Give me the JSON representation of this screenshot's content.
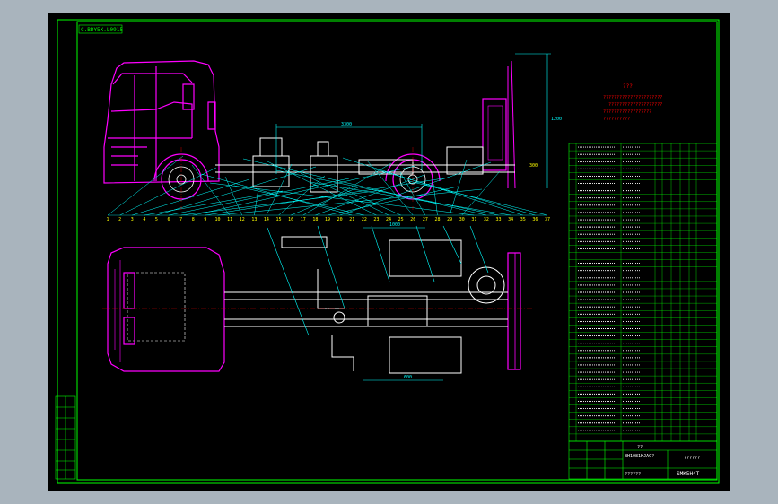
{
  "drawing": {
    "label_box": "C.BDY5X.L0915",
    "notes_title": "???",
    "notes_lines": [
      "??????????????????????",
      "????????????????????",
      "??????????????????",
      "??????????"
    ],
    "dim_wheelbase": "3300",
    "dim_rear_overhang": "300",
    "dim_height": "1200",
    "dim_plan_top": "1000",
    "dim_plan_bottom": "600",
    "item_numbers": [
      "1",
      "2",
      "3",
      "4",
      "5",
      "6",
      "7",
      "8",
      "9",
      "10",
      "11",
      "12",
      "13",
      "14",
      "15",
      "16",
      "17",
      "18",
      "19",
      "20",
      "21",
      "22",
      "23",
      "24",
      "25",
      "26",
      "27",
      "28",
      "29",
      "30",
      "31",
      "32",
      "33",
      "34",
      "35",
      "36",
      "37"
    ]
  },
  "bom": {
    "header_qty": "??",
    "row_count": 41
  },
  "title_block": {
    "project": "??????",
    "drawing_name": "BH1081KJAG?",
    "scale_label": "??",
    "drawing_code": "SMK5H4T",
    "company": "??????"
  },
  "colors": {
    "paper": "#a9b4bd",
    "background": "#000000",
    "frame": "#00ff00",
    "truck": "#ff00ff",
    "parts": "#ffffff",
    "leaders": "#00ffff",
    "notes": "#ff0000",
    "items": "#ffff00"
  }
}
